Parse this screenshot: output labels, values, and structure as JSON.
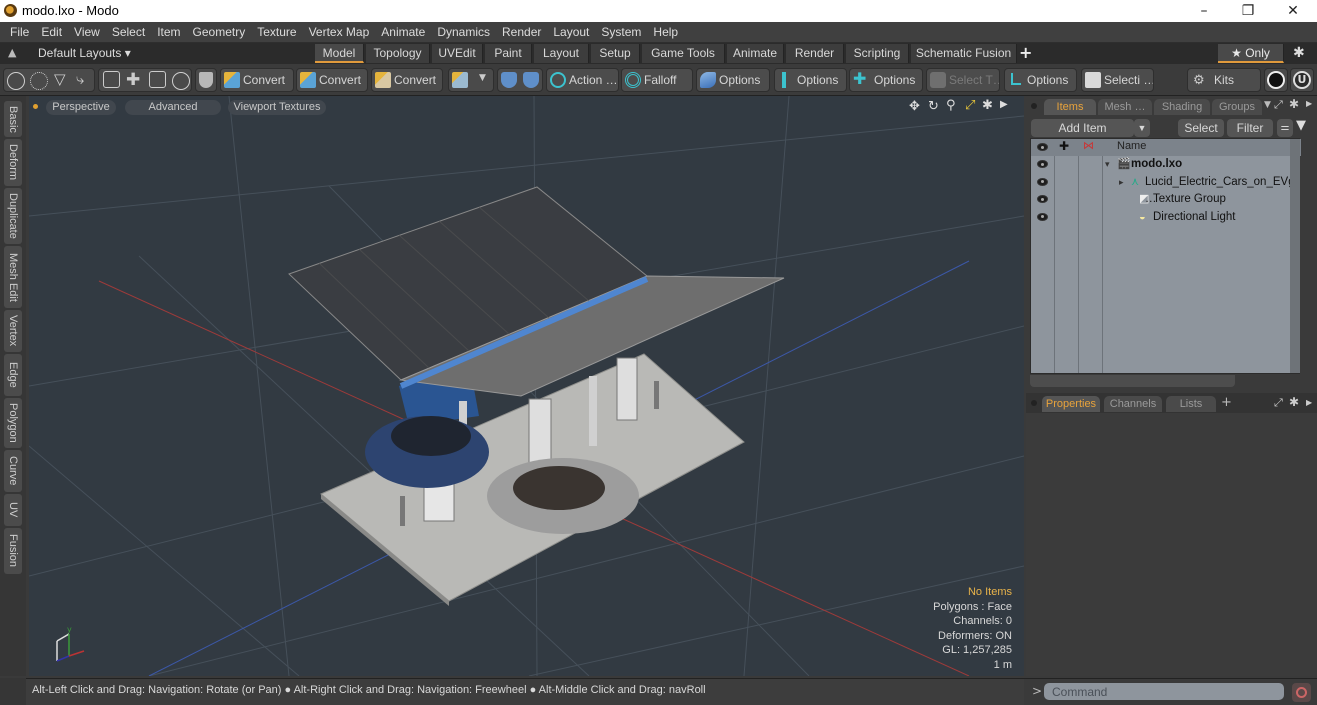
{
  "window": {
    "title": "modo.lxo - Modo",
    "minimize_glyph": "–",
    "restore_glyph": "❐",
    "close_glyph": "✕"
  },
  "menubar": {
    "items": [
      "File",
      "Edit",
      "View",
      "Select",
      "Item",
      "Geometry",
      "Texture",
      "Vertex Map",
      "Animate",
      "Dynamics",
      "Render",
      "Layout",
      "System",
      "Help"
    ]
  },
  "layoutbar": {
    "layouts_label": "Default Layouts ▾",
    "tabs": [
      "Model",
      "Topology",
      "UVEdit",
      "Paint",
      "Layout",
      "Setup",
      "Game Tools",
      "Animate",
      "Render",
      "Scripting",
      "Schematic Fusion"
    ],
    "active_tab": "Model",
    "add_tab_glyph": "+",
    "only_label": "★ Only",
    "accent_color": "#e09a3c"
  },
  "toolbar": {
    "convert1": "Convert",
    "convert2": "Convert",
    "convert3": "Convert",
    "action": "Action …",
    "falloff": "Falloff",
    "options1": "Options",
    "options2": "Options",
    "options3": "Options",
    "select_t": "Select T…",
    "options4": "Options",
    "selecti": "Selecti …",
    "kits": "Kits"
  },
  "left_tabs": [
    "Basic",
    "Deform",
    "Duplicate",
    "Mesh Edit",
    "Vertex",
    "Edge",
    "Polygon",
    "Curve",
    "UV",
    "Fusion"
  ],
  "viewport": {
    "view_mode": "Perspective",
    "shading": "Advanced",
    "textures": "Viewport Textures",
    "info": {
      "selection": "No Items",
      "polygons": "Polygons : Face",
      "channels": "Channels: 0",
      "deformers": "Deformers: ON",
      "gl": "GL: 1,257,285",
      "scale": "1 m"
    }
  },
  "items_panel": {
    "tabs": [
      "Items",
      "Mesh …",
      "Shading",
      "Groups"
    ],
    "active_tab": "Items",
    "add_item": "Add Item",
    "select": "Select",
    "filter": "Filter",
    "name_header": "Name",
    "rows": [
      {
        "name": "modo.lxo",
        "expand": "▾"
      },
      {
        "name": "Lucid_Electric_Cars_on_EVg …",
        "expand": "▸"
      },
      {
        "name": "Texture Group",
        "expand": ""
      },
      {
        "name": "Directional Light",
        "expand": ""
      }
    ]
  },
  "properties_panel": {
    "tabs": [
      "Properties",
      "Channels",
      "Lists"
    ],
    "active_tab": "Properties",
    "add_glyph": "+"
  },
  "statusbar": {
    "hint": "Alt-Left Click and Drag: Navigation: Rotate (or Pan) ● Alt-Right Click and Drag: Navigation: Freewheel ● Alt-Middle Click and Drag: navRoll"
  },
  "command": {
    "prompt": ">",
    "placeholder": "Command"
  }
}
